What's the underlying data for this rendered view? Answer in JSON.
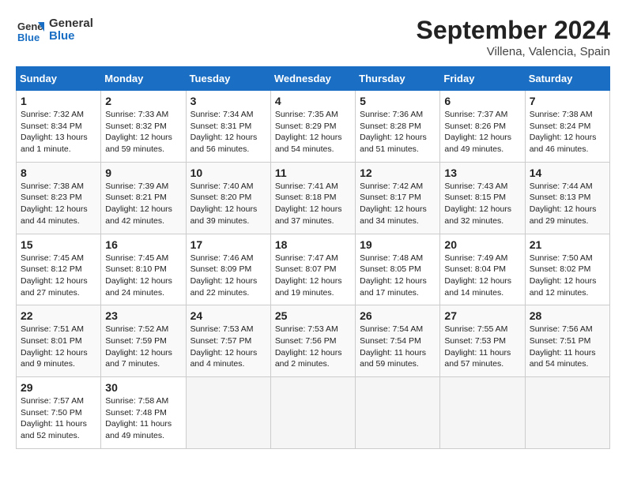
{
  "header": {
    "logo_line1": "General",
    "logo_line2": "Blue",
    "month": "September 2024",
    "location": "Villena, Valencia, Spain"
  },
  "weekdays": [
    "Sunday",
    "Monday",
    "Tuesday",
    "Wednesday",
    "Thursday",
    "Friday",
    "Saturday"
  ],
  "weeks": [
    [
      {
        "day": "1",
        "lines": [
          "Sunrise: 7:32 AM",
          "Sunset: 8:34 PM",
          "Daylight: 13 hours",
          "and 1 minute."
        ]
      },
      {
        "day": "2",
        "lines": [
          "Sunrise: 7:33 AM",
          "Sunset: 8:32 PM",
          "Daylight: 12 hours",
          "and 59 minutes."
        ]
      },
      {
        "day": "3",
        "lines": [
          "Sunrise: 7:34 AM",
          "Sunset: 8:31 PM",
          "Daylight: 12 hours",
          "and 56 minutes."
        ]
      },
      {
        "day": "4",
        "lines": [
          "Sunrise: 7:35 AM",
          "Sunset: 8:29 PM",
          "Daylight: 12 hours",
          "and 54 minutes."
        ]
      },
      {
        "day": "5",
        "lines": [
          "Sunrise: 7:36 AM",
          "Sunset: 8:28 PM",
          "Daylight: 12 hours",
          "and 51 minutes."
        ]
      },
      {
        "day": "6",
        "lines": [
          "Sunrise: 7:37 AM",
          "Sunset: 8:26 PM",
          "Daylight: 12 hours",
          "and 49 minutes."
        ]
      },
      {
        "day": "7",
        "lines": [
          "Sunrise: 7:38 AM",
          "Sunset: 8:24 PM",
          "Daylight: 12 hours",
          "and 46 minutes."
        ]
      }
    ],
    [
      {
        "day": "8",
        "lines": [
          "Sunrise: 7:38 AM",
          "Sunset: 8:23 PM",
          "Daylight: 12 hours",
          "and 44 minutes."
        ]
      },
      {
        "day": "9",
        "lines": [
          "Sunrise: 7:39 AM",
          "Sunset: 8:21 PM",
          "Daylight: 12 hours",
          "and 42 minutes."
        ]
      },
      {
        "day": "10",
        "lines": [
          "Sunrise: 7:40 AM",
          "Sunset: 8:20 PM",
          "Daylight: 12 hours",
          "and 39 minutes."
        ]
      },
      {
        "day": "11",
        "lines": [
          "Sunrise: 7:41 AM",
          "Sunset: 8:18 PM",
          "Daylight: 12 hours",
          "and 37 minutes."
        ]
      },
      {
        "day": "12",
        "lines": [
          "Sunrise: 7:42 AM",
          "Sunset: 8:17 PM",
          "Daylight: 12 hours",
          "and 34 minutes."
        ]
      },
      {
        "day": "13",
        "lines": [
          "Sunrise: 7:43 AM",
          "Sunset: 8:15 PM",
          "Daylight: 12 hours",
          "and 32 minutes."
        ]
      },
      {
        "day": "14",
        "lines": [
          "Sunrise: 7:44 AM",
          "Sunset: 8:13 PM",
          "Daylight: 12 hours",
          "and 29 minutes."
        ]
      }
    ],
    [
      {
        "day": "15",
        "lines": [
          "Sunrise: 7:45 AM",
          "Sunset: 8:12 PM",
          "Daylight: 12 hours",
          "and 27 minutes."
        ]
      },
      {
        "day": "16",
        "lines": [
          "Sunrise: 7:45 AM",
          "Sunset: 8:10 PM",
          "Daylight: 12 hours",
          "and 24 minutes."
        ]
      },
      {
        "day": "17",
        "lines": [
          "Sunrise: 7:46 AM",
          "Sunset: 8:09 PM",
          "Daylight: 12 hours",
          "and 22 minutes."
        ]
      },
      {
        "day": "18",
        "lines": [
          "Sunrise: 7:47 AM",
          "Sunset: 8:07 PM",
          "Daylight: 12 hours",
          "and 19 minutes."
        ]
      },
      {
        "day": "19",
        "lines": [
          "Sunrise: 7:48 AM",
          "Sunset: 8:05 PM",
          "Daylight: 12 hours",
          "and 17 minutes."
        ]
      },
      {
        "day": "20",
        "lines": [
          "Sunrise: 7:49 AM",
          "Sunset: 8:04 PM",
          "Daylight: 12 hours",
          "and 14 minutes."
        ]
      },
      {
        "day": "21",
        "lines": [
          "Sunrise: 7:50 AM",
          "Sunset: 8:02 PM",
          "Daylight: 12 hours",
          "and 12 minutes."
        ]
      }
    ],
    [
      {
        "day": "22",
        "lines": [
          "Sunrise: 7:51 AM",
          "Sunset: 8:01 PM",
          "Daylight: 12 hours",
          "and 9 minutes."
        ]
      },
      {
        "day": "23",
        "lines": [
          "Sunrise: 7:52 AM",
          "Sunset: 7:59 PM",
          "Daylight: 12 hours",
          "and 7 minutes."
        ]
      },
      {
        "day": "24",
        "lines": [
          "Sunrise: 7:53 AM",
          "Sunset: 7:57 PM",
          "Daylight: 12 hours",
          "and 4 minutes."
        ]
      },
      {
        "day": "25",
        "lines": [
          "Sunrise: 7:53 AM",
          "Sunset: 7:56 PM",
          "Daylight: 12 hours",
          "and 2 minutes."
        ]
      },
      {
        "day": "26",
        "lines": [
          "Sunrise: 7:54 AM",
          "Sunset: 7:54 PM",
          "Daylight: 11 hours",
          "and 59 minutes."
        ]
      },
      {
        "day": "27",
        "lines": [
          "Sunrise: 7:55 AM",
          "Sunset: 7:53 PM",
          "Daylight: 11 hours",
          "and 57 minutes."
        ]
      },
      {
        "day": "28",
        "lines": [
          "Sunrise: 7:56 AM",
          "Sunset: 7:51 PM",
          "Daylight: 11 hours",
          "and 54 minutes."
        ]
      }
    ],
    [
      {
        "day": "29",
        "lines": [
          "Sunrise: 7:57 AM",
          "Sunset: 7:50 PM",
          "Daylight: 11 hours",
          "and 52 minutes."
        ]
      },
      {
        "day": "30",
        "lines": [
          "Sunrise: 7:58 AM",
          "Sunset: 7:48 PM",
          "Daylight: 11 hours",
          "and 49 minutes."
        ]
      },
      {
        "day": "",
        "lines": []
      },
      {
        "day": "",
        "lines": []
      },
      {
        "day": "",
        "lines": []
      },
      {
        "day": "",
        "lines": []
      },
      {
        "day": "",
        "lines": []
      }
    ]
  ]
}
